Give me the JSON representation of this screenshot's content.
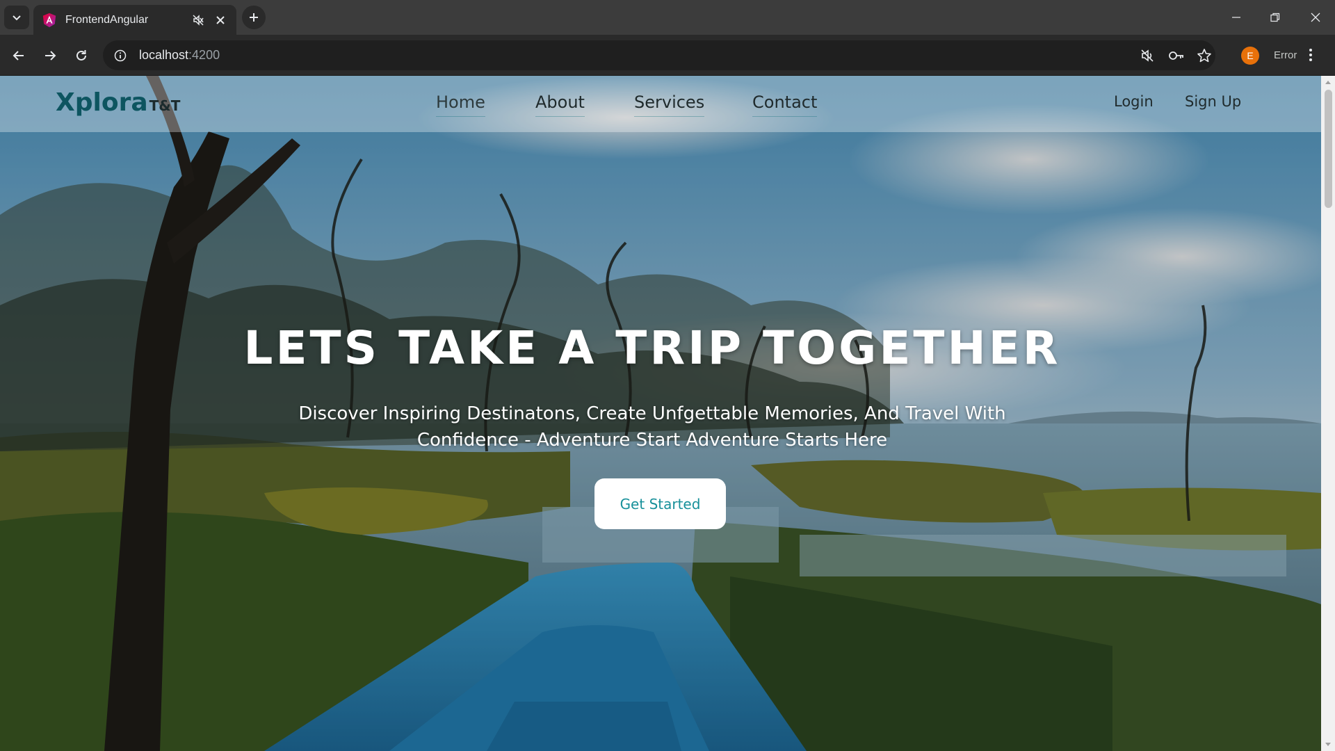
{
  "browser": {
    "tab": {
      "title": "FrontendAngular"
    },
    "address": {
      "host": "localhost",
      "port": ":4200"
    },
    "profile_initial": "E",
    "error_label": "Error"
  },
  "site": {
    "logo": {
      "main": "Xplora",
      "sub": "T&T"
    },
    "nav": {
      "home": "Home",
      "about": "About",
      "services": "Services",
      "contact": "Contact"
    },
    "auth": {
      "login": "Login",
      "signup": "Sign Up"
    },
    "hero": {
      "title": "LETS TAKE A TRIP TOGETHER",
      "subtitle_line1": "Discover Inspiring Destinatons, Create Unfgettable Memories, And Travel With",
      "subtitle_line2": "Confidence - Adventure Start Adventure Starts Here",
      "cta": "Get Started"
    }
  },
  "colors": {
    "brand_teal": "#0d5560",
    "cta_text": "#17909a",
    "avatar": "#e8710a"
  }
}
